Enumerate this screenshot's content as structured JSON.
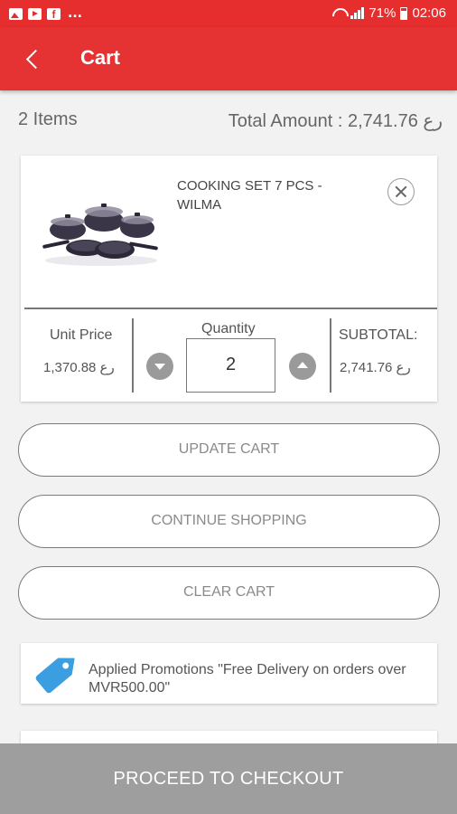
{
  "status_bar": {
    "battery": "71%",
    "time": "02:06",
    "overflow": "..."
  },
  "app_bar": {
    "title": "Cart",
    "color": "#e53333"
  },
  "summary": {
    "items_count": "2 Items",
    "total_amount": "Total Amount : 2,741.76 رع"
  },
  "cart_items": [
    {
      "name": "COOKING SET 7 PCS - WILMA",
      "unit_price_label": "Unit Price",
      "unit_price": "رع 1,370.88",
      "quantity_label": "Quantity",
      "quantity": "2",
      "subtotal_label": "SUBTOTAL:",
      "subtotal": "رع 2,741.76"
    }
  ],
  "actions": {
    "update_cart": "UPDATE CART",
    "continue_shopping": "CONTINUE SHOPPING",
    "clear_cart": "CLEAR CART"
  },
  "promotion": {
    "text": "Applied Promotions \"Free Delivery on  orders over MVR500.00\"",
    "tag_color": "#3a9ee0"
  },
  "checkout": {
    "label": "PROCEED TO CHECKOUT"
  }
}
